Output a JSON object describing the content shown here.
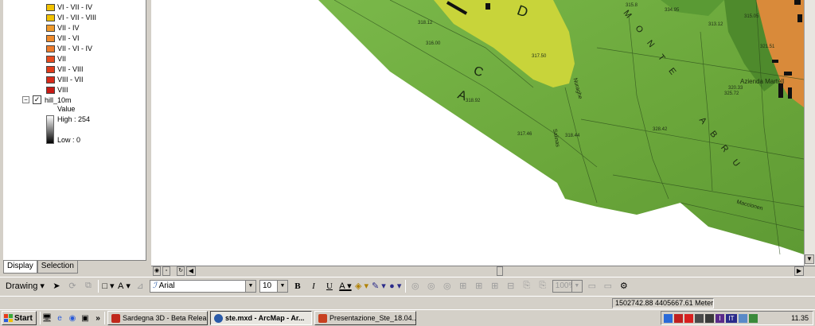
{
  "legend": {
    "classes": [
      {
        "label": "VI - VII - IV",
        "color": "#f2c200"
      },
      {
        "label": "VI - VII - VIII",
        "color": "#f2c200"
      },
      {
        "label": "VII - IV",
        "color": "#f09a2a"
      },
      {
        "label": "VII - VI",
        "color": "#f08a2a"
      },
      {
        "label": "VII - VI - IV",
        "color": "#ee7a2a"
      },
      {
        "label": "VII",
        "color": "#e84a1e"
      },
      {
        "label": "VII - VIII",
        "color": "#e03a1a"
      },
      {
        "label": "VIII - VII",
        "color": "#d82a1a"
      },
      {
        "label": "VIII",
        "color": "#c81a14"
      }
    ],
    "layer_name": "hill_10m",
    "value_label": "Value",
    "high_label": "High : 254",
    "low_label": "Low : 0",
    "tabs": [
      "Display",
      "Selection"
    ]
  },
  "map": {
    "labels": [
      {
        "text": "D",
        "size": "large"
      },
      {
        "text": "C",
        "size": "large"
      },
      {
        "text": "A",
        "size": "large"
      },
      {
        "text": "M O N T E",
        "size": "spaced"
      },
      {
        "text": "A B R U",
        "size": "spaced"
      },
      {
        "text": "Azienda Martell",
        "size": "small"
      },
      {
        "text": "Nuraghe",
        "size": "small"
      },
      {
        "text": "Salinas",
        "size": "small"
      },
      {
        "text": "Maccionen",
        "size": "small"
      }
    ],
    "elevations": [
      "315.8",
      "317.50",
      "316.00",
      "318.12",
      "318.92",
      "317.46",
      "318.44",
      "328.42",
      "325.72",
      "321.51",
      "320.33",
      "334.95",
      "315.05",
      "313.12"
    ]
  },
  "drawing_toolbar": {
    "drawing_label": "Drawing",
    "font_name": "Arial",
    "font_size": "10",
    "bold": "B",
    "italic": "I",
    "underline": "U",
    "zoom_value": "100%",
    "text_tool": "A"
  },
  "status_bar": {
    "coordinates": "1502742.88  4405667.61 Meters"
  },
  "taskbar": {
    "start_label": "Start",
    "more_label": "»",
    "tasks": [
      {
        "label": "Sardegna 3D - Beta Release",
        "icon_color": "#c0281c"
      },
      {
        "label": "ste.mxd - ArcMap - Ar...",
        "icon_color": "#2a5aa8"
      },
      {
        "label": "Presentazione_Ste_18.04...",
        "icon_color": "#c84020"
      }
    ],
    "tray_icons": [
      "shield-icon",
      "antivirus-icon",
      "red-icon",
      "network-icon",
      "sound-icon",
      "language-i-icon",
      "language-it-icon",
      "monitor-icon",
      "security-icon"
    ],
    "tray_labels": {
      "lang_i": "I",
      "lang_it": "IT"
    },
    "clock": "11.35"
  },
  "colors": {
    "map_green": "#6aa63a",
    "map_yellow": "#c8d43a",
    "map_orange": "#d98a3a",
    "chrome": "#d4d0c8"
  }
}
